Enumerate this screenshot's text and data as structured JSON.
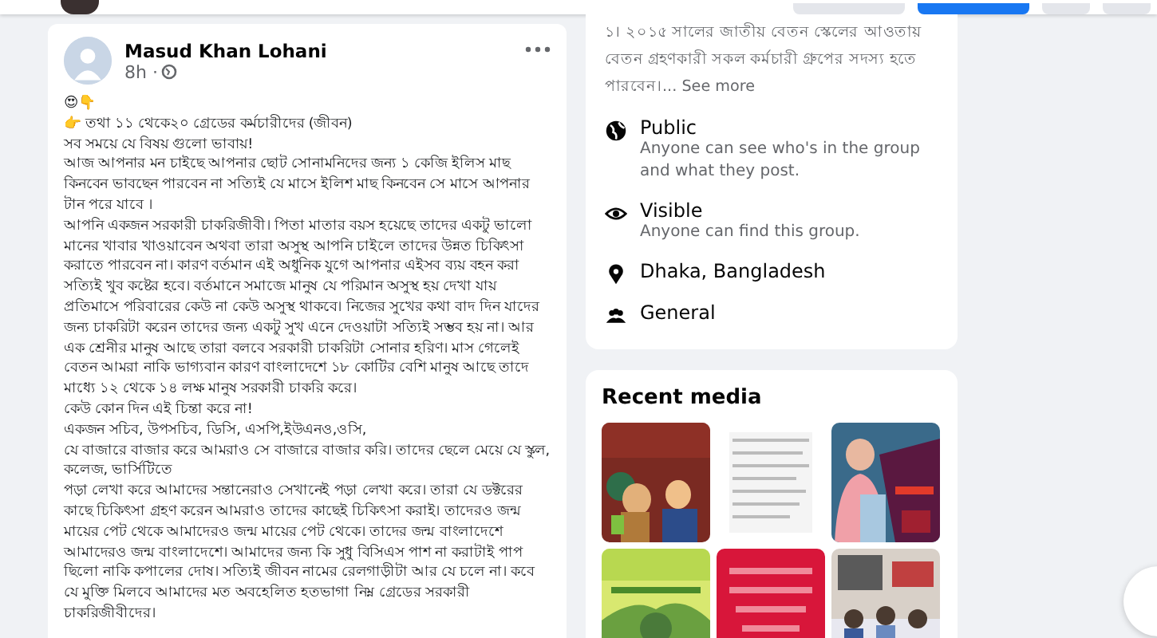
{
  "top_bar": {
    "buttons": [
      {
        "primary": false
      },
      {
        "primary": true
      },
      {
        "primary": false
      },
      {
        "primary": false
      }
    ]
  },
  "post": {
    "author": "Masud Khan Lohani",
    "time": "8h ·",
    "lines": [
      {
        "text": "😍👇"
      },
      {
        "text": "👉 তথা ১১ থেকে২০ গ্রেডের কর্মচারীদের (জীবন)"
      },
      {
        "text": "সব সময়ে যে বিষয় গুলো ভাবায়!"
      },
      {
        "text": "আজ আপনার মন চাইছে আপনার ছোট সোনামনিদের জন্য ১ কেজি ইলিস মাছ কিনবেন ভাবছেন পারবেন না সত্যিই যে মাসে ইলিশ মাছ কিনবেন সে মাসে আপনার টান পরে যাবে ।"
      },
      {
        "text": "আপনি একজন সরকারী চাকরিজীবী। পিতা মাতার বয়স হয়েছে তাদের একটু ভালো মানের খাবার খাওয়াবেন অথবা তারা অসুস্থ  আপনি চাইলে তাদের উন্নত চিকিৎসা করাতে পারবেন না।  কারণ বর্তমান এই অধুনিক যুগে আপনার এইসব ব্যয় বহন করা সত্যিই খুব কষ্টের হবে। বর্তমানে সমাজে মানুষ যে পরিমান অসুস্থ হয় দেখা যায় প্রতিমাসে পরিবারের কেউ না কেউ অসুস্থ থাকবে। নিজের সুখের কথা বাদ দিন যাদের জন্য চাকরিটা করেন তাদের জন্য একটু সুখ এনে দেওয়াটা সত্যিই  সম্ভব হয় না। আর এক শ্রেনীর মানুষ আছে তারা বলবে সরকারী চাকরিটা সোনার হরিণ। মাস গেলেই বেতন আমরা নাকি ভাগ্যবান কারণ বাংলাদেশে ১৮ কোটির বেশি মানুষ আছে তাদে  মাধ্যে ১২ থেকে ১৪ লক্ষ মানুষ সরকারী চাকরি করে।"
      },
      {
        "text": "কেউ কোন দিন এই চিন্তা করে না!"
      },
      {
        "text": "একজন সচিব, উপসচিব, ডিসি, এসপি,ইউএনও,ওসি,"
      },
      {
        "text": "যে বাজারে বাজার করে আমরাও সে বাজারে বাজার করি। তাদের ছেলে মেয়ে যে স্কুল, কলেজ, ভার্সিটিতে"
      },
      {
        "text": "পড়া লেখা করে আমাদের সন্তানেরাও সেখানেই পড়া লেখা করে। তারা যে ডক্টরের কাছে চিকিৎসা গ্রহণ করেন আমরাও তাদের কাছেই চিকিৎসা করাই। তাদেরও জন্ম মায়ের পেট থেকে আমাদেরও জন্ম মায়ের পেট থেকে। তাদের জন্ম বাংলাদেশে আমাদেরও জন্ম বাংলাদেশে। আমাদের জন্য কি সুধু বিসিএস পাশ না করাটাই পাপ ছিলো নাকি কপালের দোষ। সত্যিই জীবন নামের রেলগাড়ীটা আর যে চলে না। কবে যে মুক্তি মিলবে আমাদের মত অবহেলিত  হতভাগা নিম্ন গ্রেডের সরকারী চাকরিজীবীদের।"
      }
    ]
  },
  "about": {
    "description": "১। ২০১৫ সালের জাতীয় বেতন স্কেলের আওতায় বেতন গ্রহণকারী সকল কর্মচারী গ্রুপের সদস্য হতে পারবেন।...",
    "see_more": "See more",
    "items": [
      {
        "kind": "public",
        "title": "Public",
        "text": "Anyone can see who's in the group and what they post."
      },
      {
        "kind": "visible",
        "title": "Visible",
        "text": "Anyone can find this group."
      },
      {
        "kind": "location",
        "title": "Dhaka, Bangladesh"
      },
      {
        "kind": "category",
        "title": "General"
      }
    ]
  },
  "recent_media": {
    "title": "Recent media"
  }
}
